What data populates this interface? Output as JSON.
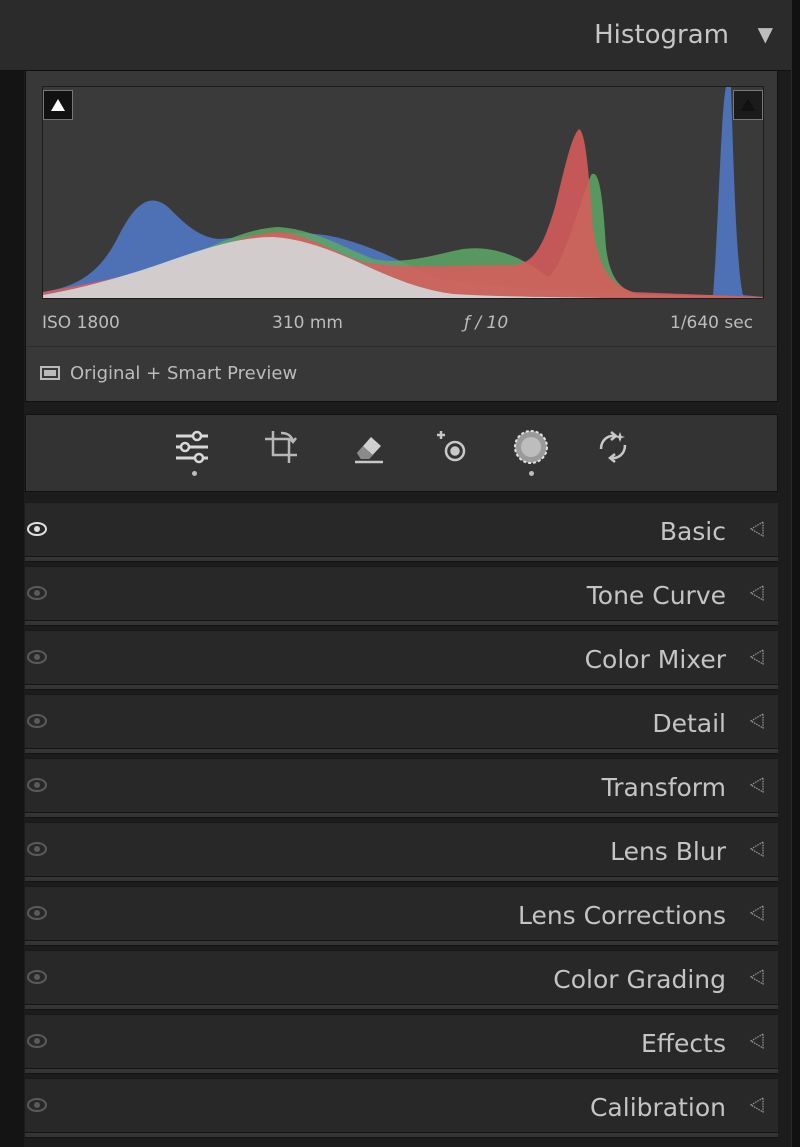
{
  "histogram": {
    "title": "Histogram",
    "collapse_arrow": "▼",
    "iso": "ISO 1800",
    "focal_length": "310 mm",
    "aperture": "ƒ / 10",
    "shutter_speed": "1/640 sec",
    "preview_label": "Original + Smart Preview",
    "preview_icon": "preview-rectangle-icon",
    "colors": {
      "red": "#d22b2b",
      "green": "#2e8f3a",
      "blue": "#1d4fb0",
      "gray": "#c5c5c5"
    }
  },
  "tools": [
    {
      "name": "edit-sliders-icon",
      "active_dot": true
    },
    {
      "name": "crop-rotate-icon",
      "active_dot": false
    },
    {
      "name": "eraser-remove-icon",
      "active_dot": false
    },
    {
      "name": "red-eye-icon",
      "active_dot": false
    },
    {
      "name": "masking-icon",
      "active_dot": true
    },
    {
      "name": "presets-icon",
      "active_dot": false
    }
  ],
  "panels": [
    {
      "label": "Basic",
      "eye_bright": true
    },
    {
      "label": "Tone Curve",
      "eye_bright": false
    },
    {
      "label": "Color Mixer",
      "eye_bright": false
    },
    {
      "label": "Detail",
      "eye_bright": false
    },
    {
      "label": "Transform",
      "eye_bright": false
    },
    {
      "label": "Lens Blur",
      "eye_bright": false
    },
    {
      "label": "Lens Corrections",
      "eye_bright": false
    },
    {
      "label": "Color Grading",
      "eye_bright": false
    },
    {
      "label": "Effects",
      "eye_bright": false
    },
    {
      "label": "Calibration",
      "eye_bright": false
    }
  ]
}
